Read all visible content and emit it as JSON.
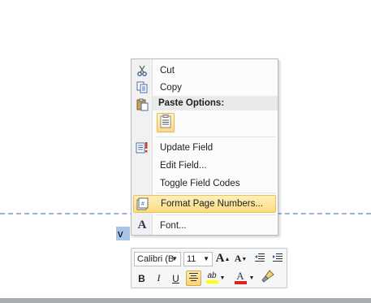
{
  "document": {
    "selected_text": "v"
  },
  "context_menu": {
    "items": {
      "cut": {
        "label": "Cut",
        "icon": "scissors-icon"
      },
      "copy": {
        "label": "Copy",
        "icon": "copy-icon"
      },
      "paste_options_header": {
        "label": "Paste Options:",
        "icon": "clipboard-icon"
      },
      "paste_keep_text": {
        "icon": "paste-keep-text-only-icon"
      },
      "update_field": {
        "label": "Update Field",
        "icon": "update-field-icon"
      },
      "edit_field": {
        "label": "Edit Field..."
      },
      "toggle_field_codes": {
        "label": "Toggle Field Codes"
      },
      "format_page_numbers": {
        "label": "Format Page Numbers...",
        "icon": "page-number-format-icon",
        "highlighted": true
      },
      "font": {
        "label": "Font...",
        "icon": "font-A-icon"
      }
    }
  },
  "mini_toolbar": {
    "font_name": "Calibri (B",
    "font_size": "11",
    "grow_font_label": "A",
    "shrink_font_label": "A",
    "bold_label": "B",
    "italic_label": "I",
    "underline_label": "U",
    "highlight_label": "ab",
    "font_color_label": "A",
    "colors": {
      "highlight": "#ffff00",
      "font_color": "#e02020",
      "accent": "#fbd37a"
    }
  }
}
